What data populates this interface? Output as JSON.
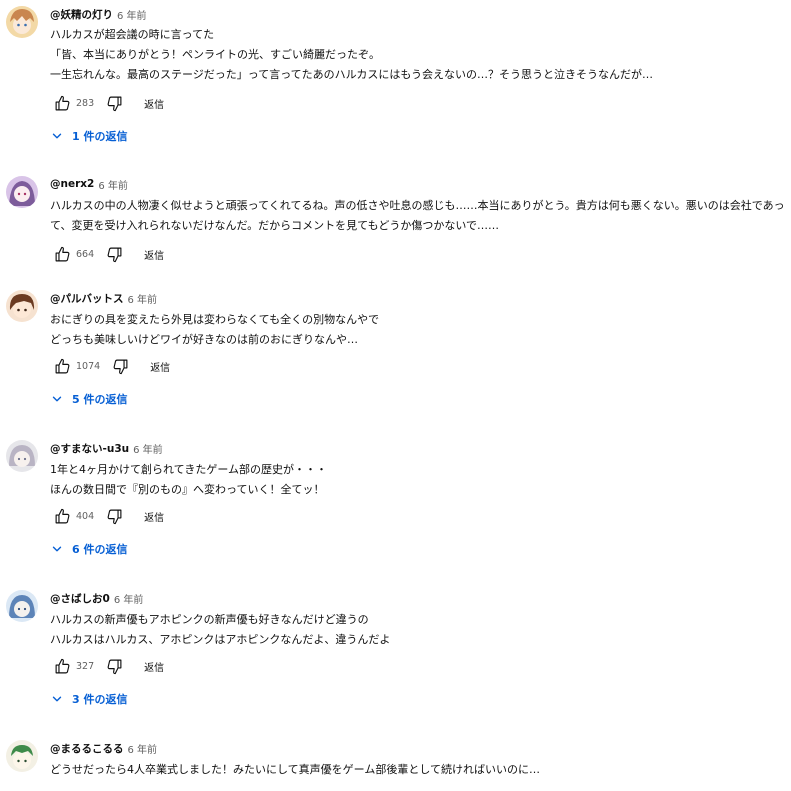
{
  "comments": [
    {
      "author": "@妖精の灯り",
      "time": "6 年前",
      "text": "ハルカスが超会議の時に言ってた\n「皆、本当にありがとう！ペンライトの光、すごい綺麗だったぞ。\n一生忘れんな。最高のステージだった」って言ってたあのハルカスにはもう会えないの…？そう思うと泣きそうなんだが…",
      "likes": "283",
      "reply_label": "返信",
      "replies_label": "1 件の返信",
      "avatar_colors": [
        "#f3d9a6",
        "#c9864f"
      ]
    },
    {
      "author": "@nerx2",
      "time": "6 年前",
      "text": "ハルカスの中の人物凄く似せようと頑張ってくれてるね。声の低さや吐息の感じも……本当にありがとう。貴方は何も悪くない。悪いのは会社であっ\nて、変更を受け入れられないだけなんだ。だからコメントを見てもどうか傷つかないで……",
      "likes": "664",
      "reply_label": "返信",
      "replies_label": "",
      "avatar_colors": [
        "#d9c4e8",
        "#7d5c9b"
      ]
    },
    {
      "author": "@パルバットス",
      "time": "6 年前",
      "text": "おにぎりの具を変えたら外見は変わらなくても全くの別物なんやで\nどっちも美味しいけどワイが好きなのは前のおにぎりなんや…",
      "likes": "1074",
      "reply_label": "返信",
      "replies_label": "5 件の返信",
      "avatar_colors": [
        "#f6e2d0",
        "#6b3b22"
      ]
    },
    {
      "author": "@すまない-u3u",
      "time": "6 年前",
      "text": "1年と4ヶ月かけて創られてきたゲーム部の歴史が・・・\nほんの数日間で『別のもの』へ変わっていく！全てッ！",
      "likes": "404",
      "reply_label": "返信",
      "replies_label": "6 件の返信",
      "avatar_colors": [
        "#e6e6ea",
        "#b9b4c4"
      ]
    },
    {
      "author": "@さばしお0",
      "time": "6 年前",
      "text": "ハルカスの新声優もアホピンクの新声優も好きなんだけど違うの\nハルカスはハルカス、アホピンクはアホピンクなんだよ、違うんだよ",
      "likes": "327",
      "reply_label": "返信",
      "replies_label": "3 件の返信",
      "avatar_colors": [
        "#dbe8f5",
        "#5d84b8"
      ]
    },
    {
      "author": "@まるるこるる",
      "time": "6 年前",
      "text": "どうせだったら4人卒業式しました！みたいにして真声優をゲーム部後輩として続ければいいのに…",
      "likes": "",
      "reply_label": "",
      "replies_label": "",
      "avatar_colors": [
        "#f3f0e4",
        "#3f8b4a"
      ]
    }
  ]
}
